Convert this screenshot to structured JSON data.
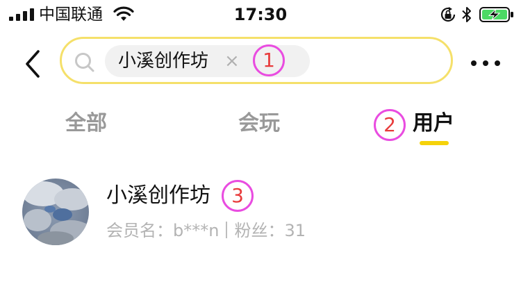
{
  "status_bar": {
    "carrier": "中国联通",
    "time": "17:30"
  },
  "search": {
    "chip_label": "小溪创作坊",
    "chip_close": "×"
  },
  "tabs": [
    {
      "label": "全部",
      "active": false
    },
    {
      "label": "会玩",
      "active": false
    },
    {
      "label": "用户",
      "active": true
    }
  ],
  "annotations": [
    "1",
    "2",
    "3"
  ],
  "results": [
    {
      "name": "小溪创作坊",
      "member_label": "会员名：",
      "member_value": "b***n",
      "fans_label": "粉丝：",
      "fans_value": "31"
    }
  ],
  "colors": {
    "search_border": "#f5e06a",
    "tab_indicator": "#f5d20a",
    "annotation_ring": "#e94ce0",
    "annotation_text": "#e83b3b",
    "battery_fill": "#4cd964"
  },
  "icons": [
    "signal-icon",
    "wifi-icon",
    "orientation-lock-icon",
    "bluetooth-icon",
    "battery-icon",
    "back-arrow-icon",
    "search-icon",
    "close-icon",
    "more-icon"
  ]
}
